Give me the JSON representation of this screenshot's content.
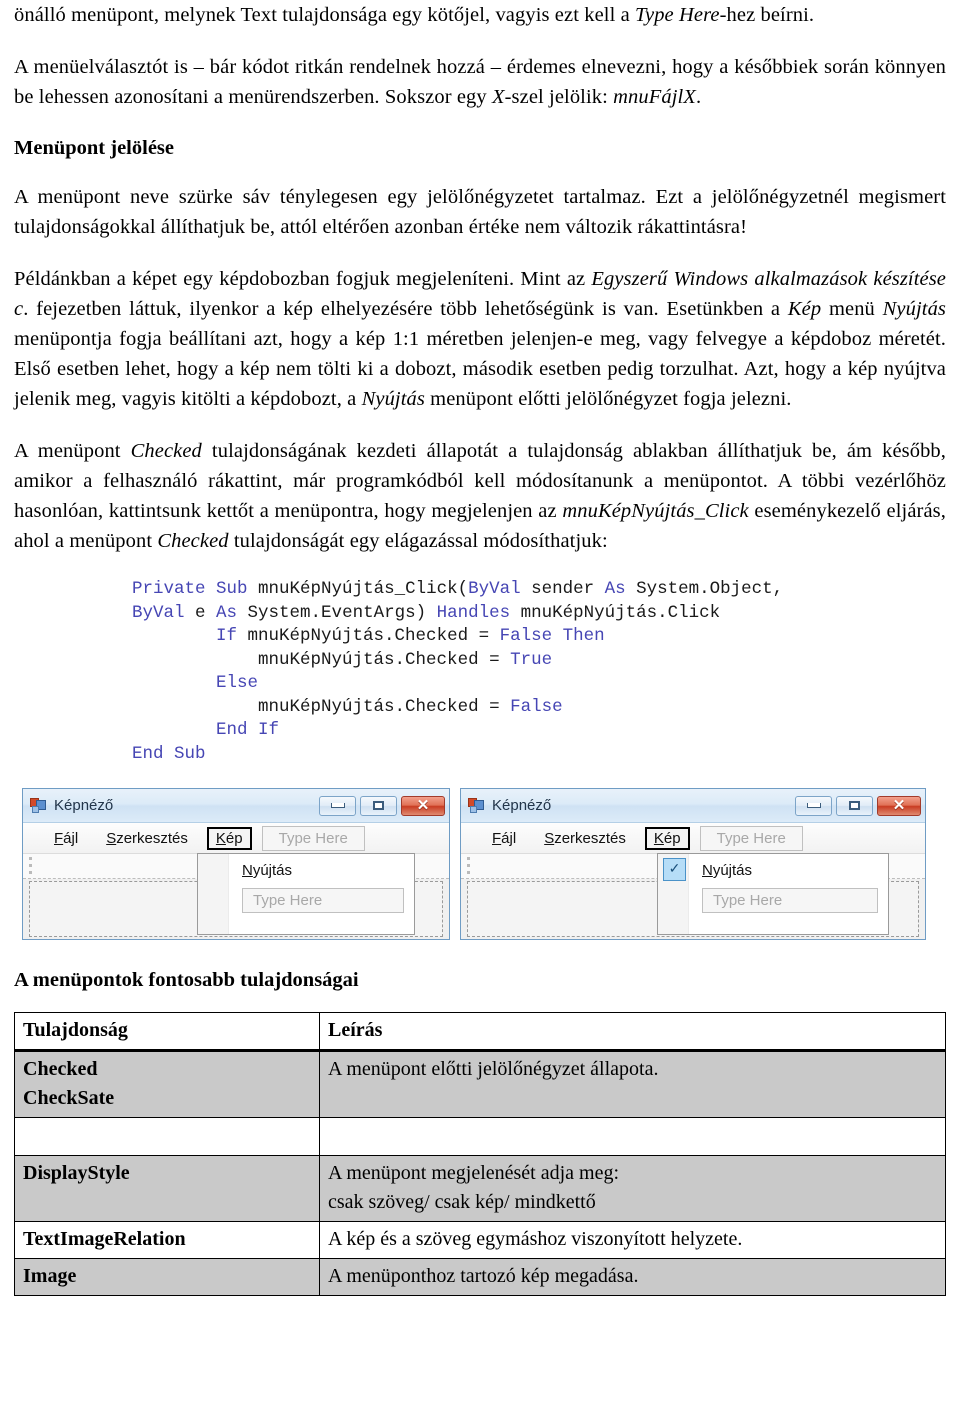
{
  "document": {
    "paragraphs": {
      "p1_part1": "önálló menüpont, melynek Text tulajdonsága egy kötőjel, vagyis ezt kell a ",
      "p1_ital": "Type Here",
      "p1_part2": "-hez beírni.",
      "p2_part1": "A menüelválasztót is – bár kódot ritkán rendelnek hozzá – érdemes elnevezni, hogy a későbbiek során könnyen be lehessen azonosítani a menürendszerben. Sokszor egy ",
      "p2_ital1": "X",
      "p2_part2": "-szel jelölik: ",
      "p2_ital2": "mnuFájlX",
      "p2_part3": ".",
      "p3": "A menüpont neve szürke sáv ténylegesen egy jelölőnégyzetet tartalmaz. Ezt a jelölőnégyzetnél megismert tulajdonságokkal állíthatjuk be, attól eltérően azonban értéke nem változik rákattintásra!",
      "p4_part1": "Példánkban a képet egy képdobozban fogjuk megjeleníteni. Mint az ",
      "p4_ital1": "Egyszerű Windows alkalmazások készítése c",
      "p4_part2": ". fejezetben láttuk, ilyenkor a kép elhelyezésére több lehetőségünk is van. Esetünkben a ",
      "p4_ital2": "Kép",
      "p4_part3": " menü ",
      "p4_ital3": "Nyújtás",
      "p4_part4": " menüpontja fogja beállítani azt, hogy a kép 1:1 méretben jelenjen-e meg, vagy felvegye a képdoboz méretét. Első esetben lehet, hogy a kép nem tölti ki a dobozt, második esetben pedig torzulhat. Azt, hogy a kép nyújtva jelenik meg, vagyis kitölti a képdobozt, a ",
      "p4_ital4": "Nyújtás",
      "p4_part5": " menüpont előtti jelölőnégyzet fogja jelezni.",
      "p5_part1": "A menüpont ",
      "p5_ital1": "Checked",
      "p5_part2": " tulajdonságának kezdeti állapotát a tulajdonság ablakban állíthatjuk be, ám később, amikor a felhasználó rákattint, már programkódból kell módosítanunk a menüpontot. A többi vezérlőhöz hasonlóan, kattintsunk kettőt a menüpontra, hogy megjelenjen az ",
      "p5_ital2": "mnuKépNyújtás_Click",
      "p5_part3": " eseménykezelő eljárás, ahol a menüpont ",
      "p5_ital3": "Checked",
      "p5_part4": " tulajdonságát egy elágazással módosíthatjuk:"
    },
    "headings": {
      "section": "Menüpont jelölése",
      "table": "A menüpontok fontosabb tulajdonságai"
    },
    "code": {
      "line1_kw1": "Private",
      "line1_kw2": "Sub",
      "line1_name": " mnuKépNyújtás_Click(",
      "line1_kw3": "ByVal",
      "line1_rest": " sender ",
      "line1_kw4": "As",
      "line1_rest2": " System.Object,",
      "line2_kw1": "ByVal",
      "line2_t1": " e ",
      "line2_kw2": "As",
      "line2_t2": " System.EventArgs) ",
      "line2_kw3": "Handles",
      "line2_t3": " mnuKépNyújtás.Click",
      "line3_kw1": "If",
      "line3_t1": " mnuKépNyújtás.Checked = ",
      "line3_kw2": "False",
      "line3_kw3": "Then",
      "line4_t1": "mnuKépNyújtás.Checked = ",
      "line4_kw1": "True",
      "line5_kw1": "Else",
      "line6_t1": "mnuKépNyújtás.Checked = ",
      "line6_kw1": "False",
      "line7_kw1": "End",
      "line7_kw2": "If",
      "line8_kw1": "End",
      "line8_kw2": "Sub",
      "keyword_color": "#4646b4"
    }
  },
  "screenshots": {
    "window1": {
      "title": "Képnéző",
      "minimize_label": "",
      "maximize_label": "",
      "close_label": "✕",
      "menu": {
        "file": "Fájl",
        "file_mnemonic": "F",
        "edit": "Szerkesztés",
        "edit_mnemonic": "S",
        "image": "Kép",
        "image_mnemonic": "K",
        "type_here": "Type Here"
      },
      "dropdown": {
        "item": "Nyújtás",
        "item_mnemonic": "N",
        "type_here": "Type Here",
        "checked": false
      }
    },
    "window2": {
      "title": "Képnéző",
      "close_label": "✕",
      "menu": {
        "file": "Fájl",
        "file_mnemonic": "F",
        "edit": "Szerkesztés",
        "edit_mnemonic": "S",
        "image": "Kép",
        "image_mnemonic": "K",
        "type_here": "Type Here"
      },
      "dropdown": {
        "item": "Nyújtás",
        "item_mnemonic": "N",
        "type_here": "Type Here",
        "checked": true,
        "check_glyph": "✓",
        "check_fill": "#b6ddf7",
        "check_border": "#4a92c8"
      }
    }
  },
  "properties_table": {
    "headers": [
      "Tulajdonság",
      "Leírás"
    ],
    "rows": [
      {
        "property_line1": "Checked",
        "property_line2": "CheckSate",
        "description_line1": "A menüpont előtti jelölőnégyzet állapota.",
        "description_line2": "",
        "shaded": true
      },
      {
        "property_line1": "",
        "property_line2": "",
        "description_line1": "",
        "description_line2": "",
        "shaded": false
      },
      {
        "property_line1": "DisplayStyle",
        "property_line2": "",
        "description_line1": "A menüpont megjelenését adja meg:",
        "description_line2": "csak szöveg/ csak kép/ mindkettő",
        "shaded": true
      },
      {
        "property_line1": "TextImageRelation",
        "property_line2": "",
        "description_line1": "A kép és a szöveg egymáshoz viszonyított helyzete.",
        "description_line2": "",
        "shaded": false
      },
      {
        "property_line1": "Image",
        "property_line2": "",
        "description_line1": "A menüponthoz tartozó kép megadása.",
        "description_line2": "",
        "shaded": true
      }
    ],
    "shade_color": "#c9c9c9"
  }
}
